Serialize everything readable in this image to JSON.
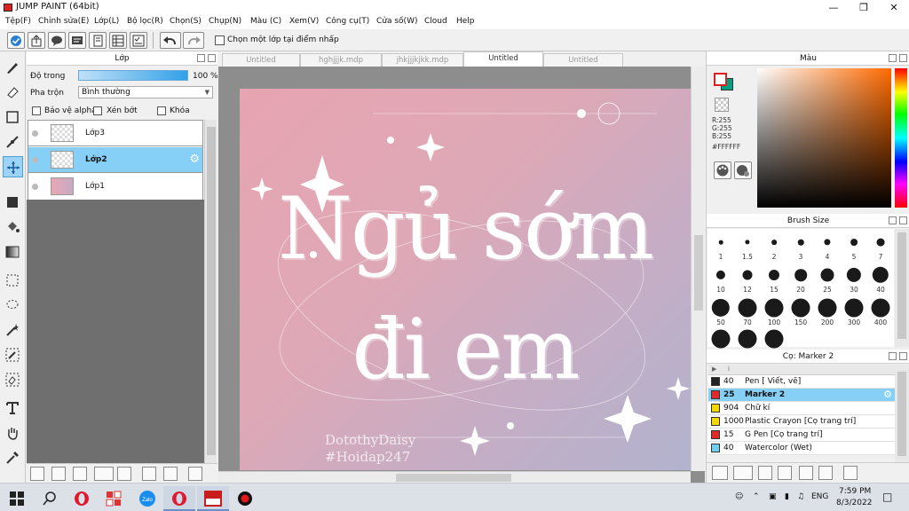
{
  "window": {
    "title": "JUMP PAINT (64bit)"
  },
  "menu": [
    "Tệp(F)",
    "Chỉnh sửa(E)",
    "Lớp(L)",
    "Bộ lọc(R)",
    "Chọn(S)",
    "Chụp(N)",
    "Màu (C)",
    "Xem(V)",
    "Công cụ(T)",
    "Cửa số(W)",
    "Cloud",
    "Help"
  ],
  "toolbar": {
    "pick_layer_label": "Chọn một lớp tại điểm nhấp"
  },
  "layer_panel": {
    "title": "Lớp",
    "opacity_label": "Độ trong",
    "opacity_value": "100 %",
    "opacity_fraction": 1.0,
    "blend_label": "Pha trộn",
    "blend_value": "Bình thường",
    "protect_alpha": "Bảo vệ alpha",
    "clipping": "Xén bớt",
    "lock": "Khóa",
    "layers": [
      {
        "name": "Lớp3"
      },
      {
        "name": "Lớp2",
        "selected": true
      },
      {
        "name": "Lớp1"
      }
    ]
  },
  "documents": {
    "tabs": [
      "Untitled",
      "hghjjjk.mdp",
      "jhkjjjkjkk.mdp",
      "Untitled",
      "Untitled"
    ],
    "active_tab": 3
  },
  "artwork": {
    "title_line1": "Ngủ sớm",
    "title_line2": "đi em",
    "signature_line1": "DotothyDaisy",
    "signature_line2": "#Hoidap247"
  },
  "color_panel": {
    "title": "Màu",
    "r": "R:255",
    "g": "G:255",
    "b": "B:255",
    "hex": "#FFFFFF",
    "foreground_color": "#FFFFFF",
    "background_color": "#00A080"
  },
  "brush_panel": {
    "title": "Brush Size",
    "sizes": [
      "1",
      "1.5",
      "2",
      "3",
      "4",
      "5",
      "7",
      "10",
      "12",
      "15",
      "20",
      "25",
      "30",
      "40",
      "50",
      "70",
      "100",
      "150",
      "200",
      "300",
      "400"
    ]
  },
  "tool_panel": {
    "title": "Cọ: Marker 2",
    "items": [
      {
        "size": "40",
        "name": "Pen [ Viết, vẽ]",
        "color": "#222222"
      },
      {
        "size": "25",
        "name": "Marker 2",
        "color": "#e02a2a",
        "selected": true
      },
      {
        "size": "904",
        "name": "Chữ kí",
        "color": "#f2d800"
      },
      {
        "size": "1000",
        "name": "Plastic Crayon [Cọ trang trí]",
        "color": "#f2d800"
      },
      {
        "size": "15",
        "name": "G Pen [Cọ trang trí]",
        "color": "#e02a2a"
      },
      {
        "size": "40",
        "name": "Watercolor (Wet)",
        "color": "#6fd0f0"
      }
    ]
  },
  "taskbar": {
    "language": "ENG",
    "time": "7:59 PM",
    "date": "8/3/2022"
  }
}
